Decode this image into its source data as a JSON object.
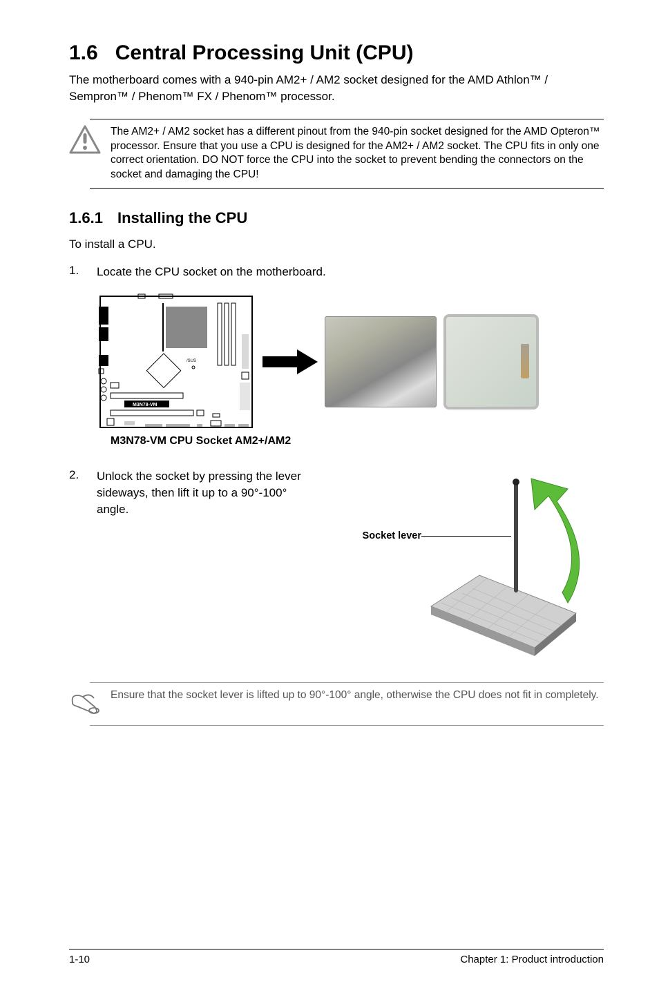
{
  "heading": {
    "number": "1.6",
    "title": "Central Processing Unit (CPU)"
  },
  "intro": "The motherboard comes with a 940-pin AM2+ / AM2 socket designed for the AMD Athlon™ / Sempron™ / Phenom™ FX / Phenom™ processor.",
  "warning_note": "The AM2+ / AM2 socket has a different pinout from the 940-pin socket designed for the AMD Opteron™ processor. Ensure that you use a CPU is designed for the AM2+ / AM2 socket. The CPU fits in only one correct orientation. DO NOT force the CPU into the socket to prevent bending the connectors on the socket and damaging the CPU!",
  "subheading": {
    "number": "1.6.1",
    "title": "Installing the CPU"
  },
  "install_intro": "To install a CPU.",
  "steps": [
    {
      "num": "1.",
      "text": "Locate the CPU socket on the motherboard."
    },
    {
      "num": "2.",
      "text": "Unlock the socket by pressing the lever sideways, then lift it up to a 90°-100° angle."
    }
  ],
  "diagram_label": "M3N78-VM",
  "figure_caption": "M3N78-VM CPU Socket AM2+/AM2",
  "socket_lever_label": "Socket lever",
  "tip_note": "Ensure that the socket  lever is lifted up to 90°-100° angle, otherwise the CPU does not fit in completely.",
  "footer": {
    "page": "1-10",
    "chapter": "Chapter 1: Product introduction"
  }
}
